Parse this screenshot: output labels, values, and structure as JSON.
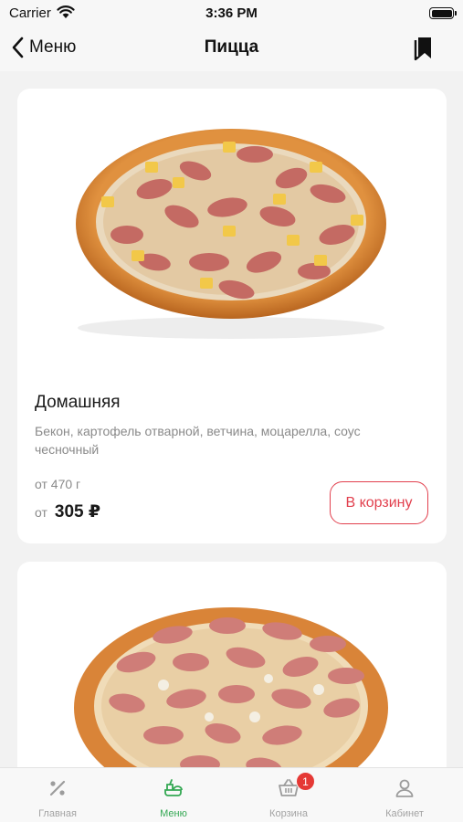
{
  "status_bar": {
    "carrier": "Carrier",
    "time": "3:36 PM"
  },
  "nav": {
    "back_label": "Меню",
    "title": "Пицца",
    "bookmark_icon": "bookmark-icon"
  },
  "products": [
    {
      "name": "Домашняя",
      "description": "Бекон, картофель отварной, ветчина, моцарелла, соус чесночный",
      "weight": "от 470 г",
      "price_prefix": "от",
      "price": "305 ₽",
      "cart_label": "В корзину"
    }
  ],
  "tab_bar": {
    "tabs": [
      {
        "label": "Главная",
        "icon": "percent-icon",
        "active": false
      },
      {
        "label": "Меню",
        "icon": "menu-food-icon",
        "active": true
      },
      {
        "label": "Корзина",
        "icon": "basket-icon",
        "active": false,
        "badge": "1"
      },
      {
        "label": "Кабинет",
        "icon": "user-icon",
        "active": false
      }
    ]
  },
  "colors": {
    "accent_green": "#34a853",
    "accent_red": "#e2404e",
    "badge_red": "#e53935",
    "background": "#f2f2f2"
  }
}
